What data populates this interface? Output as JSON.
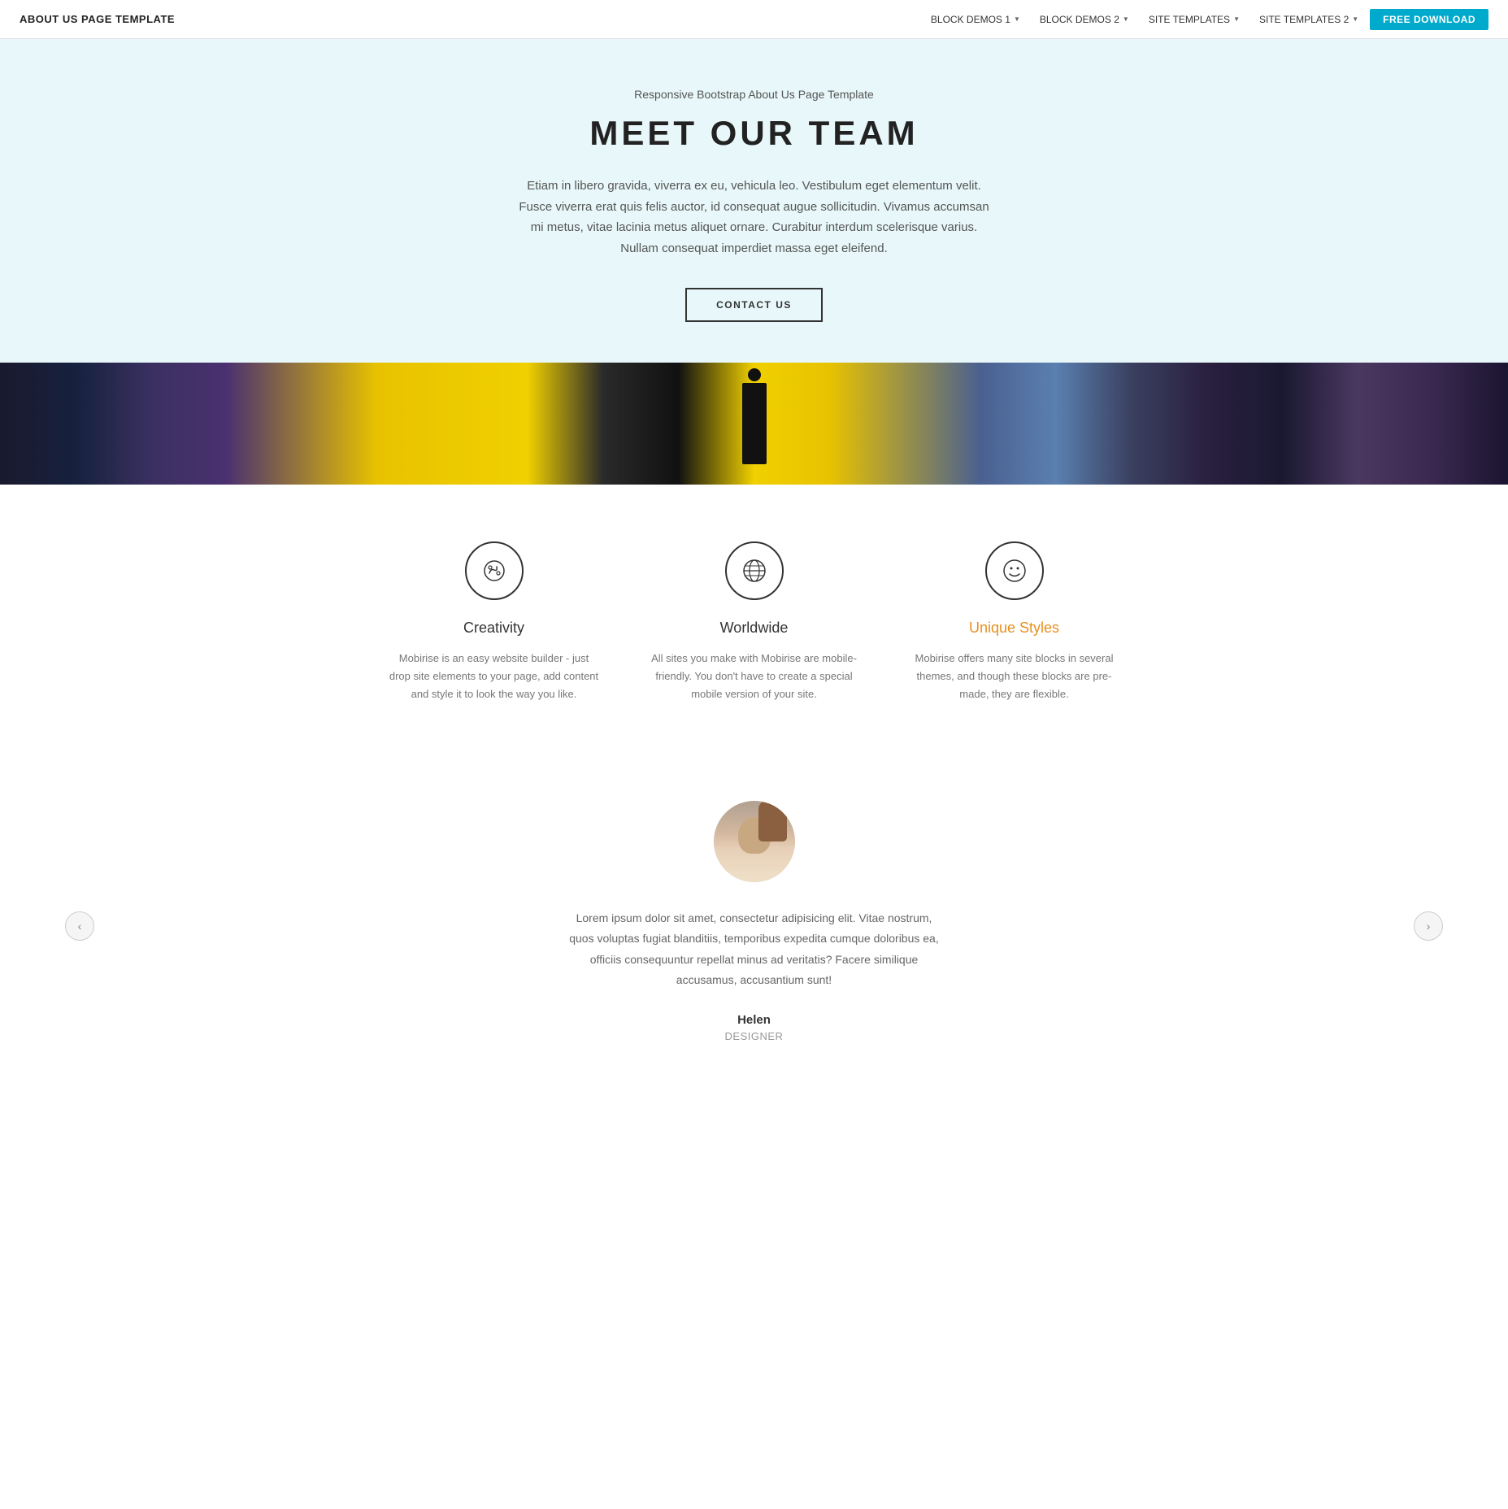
{
  "nav": {
    "brand": "ABOUT US PAGE TEMPLATE",
    "links": [
      {
        "label": "BLOCK DEMOS 1",
        "hasDropdown": true
      },
      {
        "label": "BLOCK DEMOS 2",
        "hasDropdown": true
      },
      {
        "label": "SITE TEMPLATES",
        "hasDropdown": true
      },
      {
        "label": "SITE TEMPLATES 2",
        "hasDropdown": true
      }
    ],
    "cta": "FREE DOWNLOAD"
  },
  "hero": {
    "subtitle": "Responsive Bootstrap About Us Page Template",
    "title": "MEET OUR TEAM",
    "text": "Etiam in libero gravida, viverra ex eu, vehicula leo. Vestibulum eget elementum velit. Fusce viverra erat quis felis auctor, id consequat augue sollicitudin. Vivamus accumsan mi metus, vitae lacinia metus aliquet ornare. Curabitur interdum scelerisque varius. Nullam consequat imperdiet massa eget eleifend.",
    "cta": "CONTACT US"
  },
  "features": {
    "items": [
      {
        "icon": "✦",
        "title": "Creativity",
        "accent": false,
        "desc": "Mobirise is an easy website builder - just drop site elements to your page, add content and style it to look the way you like."
      },
      {
        "icon": "⊕",
        "title": "Worldwide",
        "accent": false,
        "desc": "All sites you make with Mobirise are mobile-friendly. You don't have to create a special mobile version of your site."
      },
      {
        "icon": "☺",
        "title": "Unique Styles",
        "accent": true,
        "desc": "Mobirise offers many site blocks in several themes, and though these blocks are pre-made, they are flexible."
      }
    ]
  },
  "testimonial": {
    "text": "Lorem ipsum dolor sit amet, consectetur adipisicing elit. Vitae nostrum, quos voluptas fugiat blanditiis, temporibus expedita cumque doloribus ea, officiis consequuntur repellat minus ad veritatis? Facere similique accusamus, accusantium sunt!",
    "name": "Helen",
    "role": "DESIGNER",
    "prev_arrow": "‹",
    "next_arrow": "›"
  }
}
